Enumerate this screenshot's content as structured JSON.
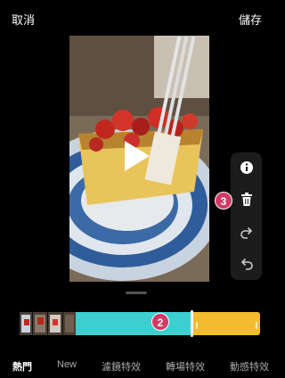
{
  "topbar": {
    "cancel_label": "取消",
    "save_label": "儲存"
  },
  "video": {
    "play_icon": "play-icon"
  },
  "tools": [
    "info-icon",
    "trash-icon",
    "redo-icon",
    "undo-icon"
  ],
  "badges": {
    "delete_step": "3",
    "timeline_step": "2"
  },
  "timeline": {
    "segments": [
      "thumbnails",
      "teal-effect",
      "yellow-effect"
    ],
    "colors": {
      "teal": "#3ccfcf",
      "yellow": "#f2bc2c",
      "badge": "#d23a63"
    }
  },
  "tabs": [
    {
      "label": "熱門",
      "active": true
    },
    {
      "label": "New",
      "active": false
    },
    {
      "label": "濾鏡特效",
      "active": false
    },
    {
      "label": "轉場特效",
      "active": false
    },
    {
      "label": "動感特效",
      "active": false
    }
  ]
}
